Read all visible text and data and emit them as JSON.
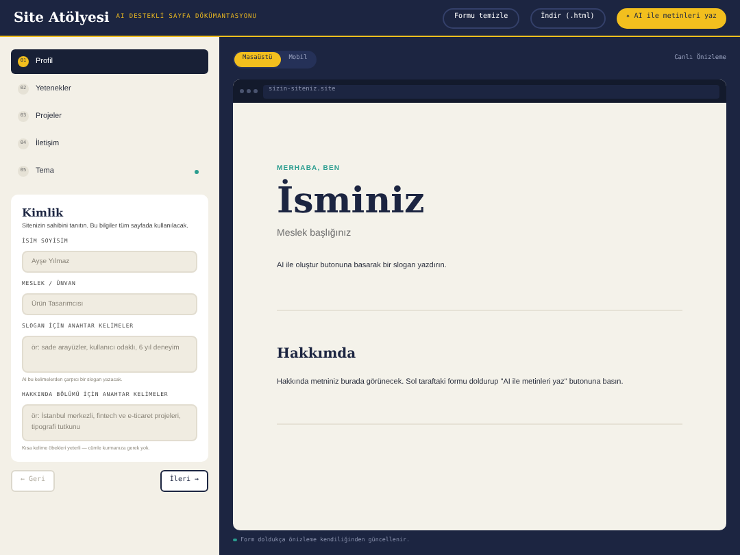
{
  "header": {
    "title": "Site Atölyesi",
    "tagline": "AI DESTEKLİ SAYFA DÖKÜMANTASYONU",
    "buttons": [
      {
        "label": "Formu temizle",
        "kind": "outline"
      },
      {
        "label": "İndir (.html)",
        "kind": "outline"
      },
      {
        "label": "✦ AI ile metinleri yaz",
        "kind": "primary"
      }
    ]
  },
  "steps": [
    {
      "number": "01",
      "label": "Profil",
      "selected": true,
      "dot": false
    },
    {
      "number": "02",
      "label": "Yetenekler",
      "selected": false,
      "dot": false
    },
    {
      "number": "03",
      "label": "Projeler",
      "selected": false,
      "dot": false
    },
    {
      "number": "04",
      "label": "İletişim",
      "selected": false,
      "dot": false
    },
    {
      "number": "05",
      "label": "Tema",
      "selected": false,
      "dot": true
    }
  ],
  "form": {
    "title": "Kimlik",
    "description": "Sitenizin sahibini tanıtın. Bu bilgiler tüm sayfada kullanılacak.",
    "fields": [
      {
        "label": "İSİM SOYİSİM",
        "placeholder": "Ayşe Yılmaz",
        "kind": "input"
      },
      {
        "label": "MESLEK / ÜNVAN",
        "placeholder": "Ürün Tasarımcısı",
        "kind": "input"
      },
      {
        "label": "SLOGAN İÇİN ANAHTAR KELİMELER",
        "placeholder": "ör: sade arayüzler, kullanıcı odaklı, 6 yıl deneyim",
        "kind": "textarea",
        "hint": "AI bu kelimelerden çarpıcı bir slogan yazacak."
      },
      {
        "label": "HAKKINDA BÖLÜMÜ İÇİN ANAHTAR KELİMELER",
        "placeholder": "ör: İstanbul merkezli, fintech ve e-ticaret projeleri, tipografi tutkunu",
        "kind": "textarea",
        "hint": "Kısa kelime öbekleri yeterli — cümle kurmanıza gerek yok."
      }
    ]
  },
  "nav": [
    {
      "label": "← Geri",
      "disabled": true
    },
    {
      "label": "İleri →",
      "disabled": false
    }
  ],
  "view_tabs": [
    {
      "label": "Masaüstü",
      "selected": true
    },
    {
      "label": "Mobil",
      "selected": false
    }
  ],
  "preview_label": "Canlı Önizleme",
  "browser": {
    "url": "sizin-siteniz.site"
  },
  "site": {
    "eyebrow": "MERHABA, BEN",
    "name": "İsminiz",
    "role": "Meslek başlığınız",
    "slogan": "AI ile oluştur butonuna basarak bir slogan yazdırın.",
    "about_title": "Hakkımda",
    "about_text": "Hakkında metniniz burada görünecek. Sol taraftaki formu doldurup \"AI ile metinleri yaz\" butonuna basın."
  },
  "footer_note": "Form doldukça önizleme kendiliğinden güncellenir."
}
